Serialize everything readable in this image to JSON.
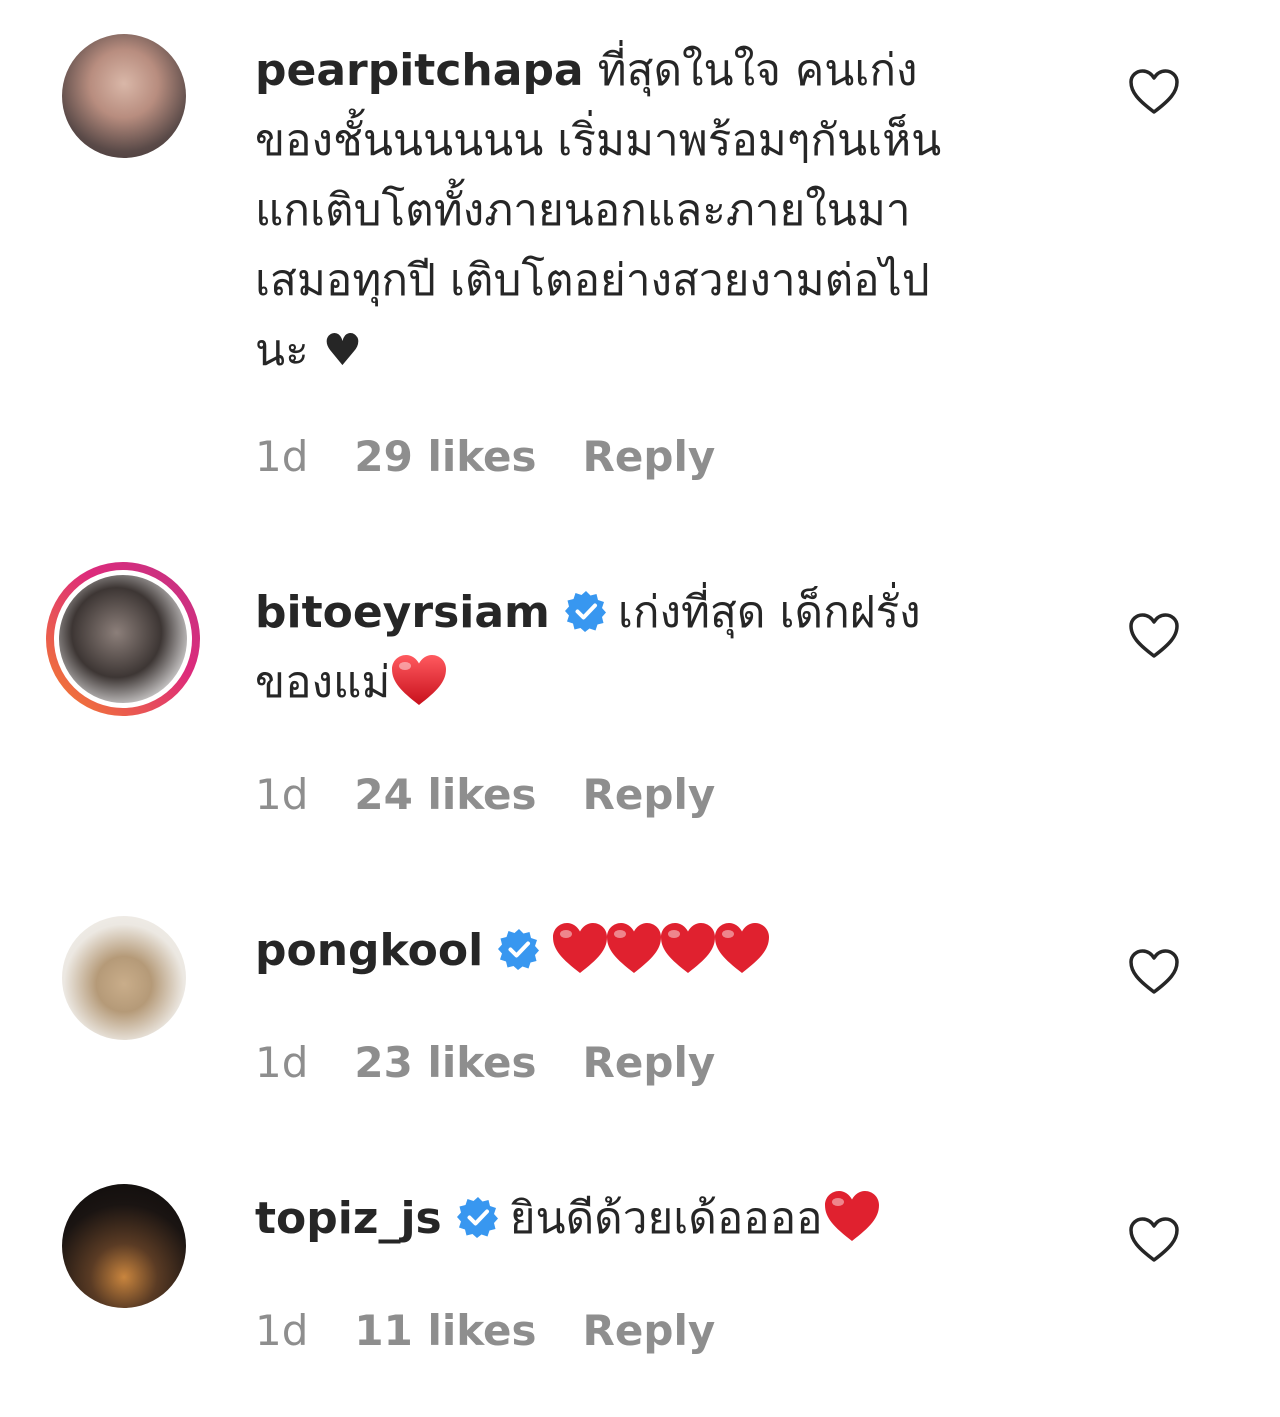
{
  "colors": {
    "text": "#262626",
    "meta": "#8e8e8e",
    "verified": "#3897f0",
    "heart": "#e0212f"
  },
  "icons": {
    "verified": "verified-badge-icon",
    "like": "heart-outline-icon",
    "emoji": "red-heart-emoji-icon"
  },
  "comments": [
    {
      "username": "pearpitchapa",
      "verified": false,
      "text_lines": [
        " ที่สุดในใจ คนเก่ง",
        "ของชั้นนนนนน เริ่มมาพร้อมๆกันเห็น",
        "แกเติบโตทั้งภายนอกและภายในมา",
        "เสมอทุกปี เติบโตอย่างสวยงามต่อไป",
        "นะ ♥"
      ],
      "time": "1d",
      "likes": "29 likes",
      "reply": "Reply"
    },
    {
      "username": "bitoeyrsiam",
      "verified": true,
      "text_lines": [
        "เก่งที่สุด เด็กฝรั่ง",
        "ของแม่"
      ],
      "emoji": "❤️",
      "time": "1d",
      "likes": "24 likes",
      "reply": "Reply"
    },
    {
      "username": "pongkool",
      "verified": true,
      "emoji": "❤️❤️❤️❤️",
      "time": "1d",
      "likes": "23 likes",
      "reply": "Reply"
    },
    {
      "username": "topiz_js",
      "verified": true,
      "text_lines": [
        "ยินดีด้วยเด้ออออ"
      ],
      "emoji": "❤️",
      "time": "1d",
      "likes": "11 likes",
      "reply": "Reply"
    }
  ]
}
